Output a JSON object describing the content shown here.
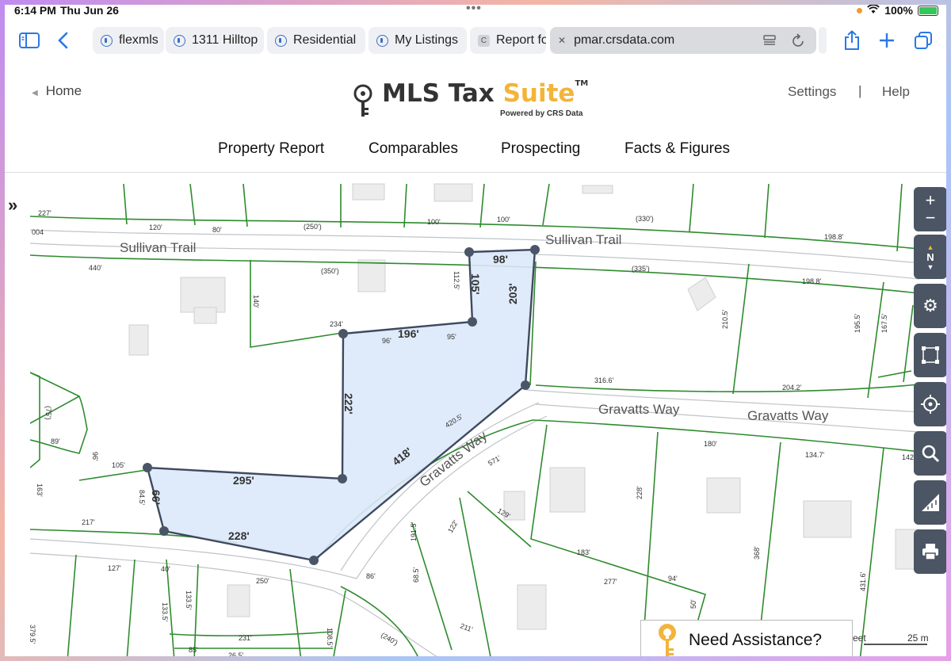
{
  "status": {
    "time": "6:14 PM",
    "date": "Thu Jun 26",
    "battery": "100%"
  },
  "tabs": [
    {
      "label": "flexmls"
    },
    {
      "label": "1311 Hilltop"
    },
    {
      "label": "Residential"
    },
    {
      "label": "My Listings"
    },
    {
      "label": "Report fo"
    },
    {
      "label": "pmar.crsdata.com"
    }
  ],
  "header": {
    "home": "Home",
    "logo_main": "MLS Tax ",
    "logo_accent": "Suite",
    "logo_tm": "TM",
    "powered": "Powered by CRS Data",
    "settings": "Settings",
    "sep": "|",
    "help": "Help"
  },
  "nav": [
    "Property Report",
    "Comparables",
    "Prospecting",
    "Facts & Figures"
  ],
  "map": {
    "streets": [
      "Sullivan Trail",
      "Sullivan Trail",
      "Gravatts Way",
      "Gravatts Way",
      "Gravatts Way"
    ],
    "parcel_dims": [
      "98'",
      "105'",
      "203'",
      "196'",
      "222'",
      "418'",
      "295'",
      "66'",
      "228'"
    ],
    "lot_labels": [
      "227'",
      "120'",
      "80'",
      "(250')",
      "100'",
      "100'",
      "(330')",
      "198.8'",
      "440'",
      "(350')",
      "140'",
      "112.5'",
      "(335')",
      "198.8'",
      "234'",
      "96'",
      "95'",
      "210.5'",
      "195.5'",
      "167.5'",
      "316.6'",
      "204.2'",
      "420.5'",
      "(75')",
      "89'",
      "96'",
      "105'",
      "163'",
      "84.5'",
      "571'",
      "180'",
      "134.7'",
      "142",
      "129'",
      "228'",
      "217'",
      "127'",
      "40'",
      "250'",
      "191.5'",
      "122'",
      "183'",
      "86'",
      "68.5'",
      "277'",
      "94'",
      "368'",
      "431.6'",
      "133.5'",
      "133.5'",
      "231'",
      "108.5'",
      "(240')",
      "211'",
      "379.5'",
      "85'",
      "26.5'",
      "50'",
      "004"
    ],
    "scale_feet": "eet",
    "scale_m": "25 m"
  },
  "controls": {
    "north": "N"
  },
  "assist": {
    "label": "Need Assistance?"
  },
  "colors": {
    "lot_line": "#2e8b2e",
    "parcel_fill": "#dbe8fa",
    "parcel_stroke": "#3e4a5e",
    "accent": "#f2b43a",
    "link_blue": "#2a78e4"
  }
}
